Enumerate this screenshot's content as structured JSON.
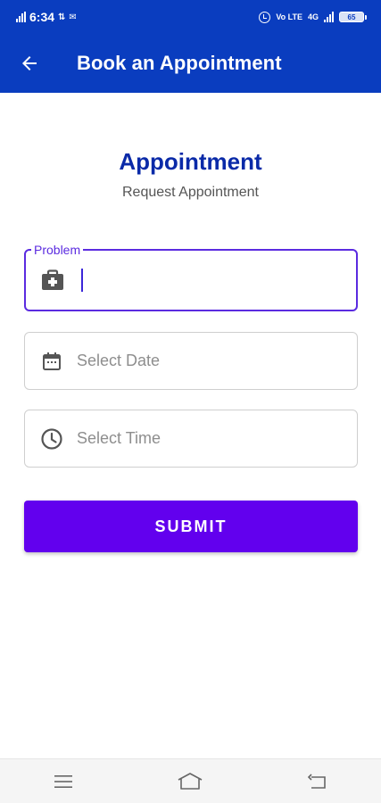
{
  "status_bar": {
    "time": "6:34",
    "network_left": "4G",
    "carrier_text": "Vo LTE",
    "network_right": "4G",
    "battery": "65"
  },
  "app_bar": {
    "title": "Book an Appointment",
    "back_icon": "arrow-left-icon"
  },
  "page": {
    "heading": "Appointment",
    "subheading": "Request Appointment"
  },
  "form": {
    "problem": {
      "label": "Problem",
      "value": "",
      "icon": "medical-kit-icon"
    },
    "date": {
      "placeholder": "Select Date",
      "value": "",
      "icon": "calendar-icon"
    },
    "time": {
      "placeholder": "Select Time",
      "value": "",
      "icon": "clock-icon"
    },
    "submit_label": "SUBMIT"
  },
  "nav_bar": {
    "items": [
      "menu-icon",
      "home-icon",
      "back-icon"
    ]
  },
  "colors": {
    "app_bar": "#0a3dbf",
    "heading": "#0a2aa8",
    "accent": "#6200ee",
    "focus_border": "#5b2be0"
  }
}
